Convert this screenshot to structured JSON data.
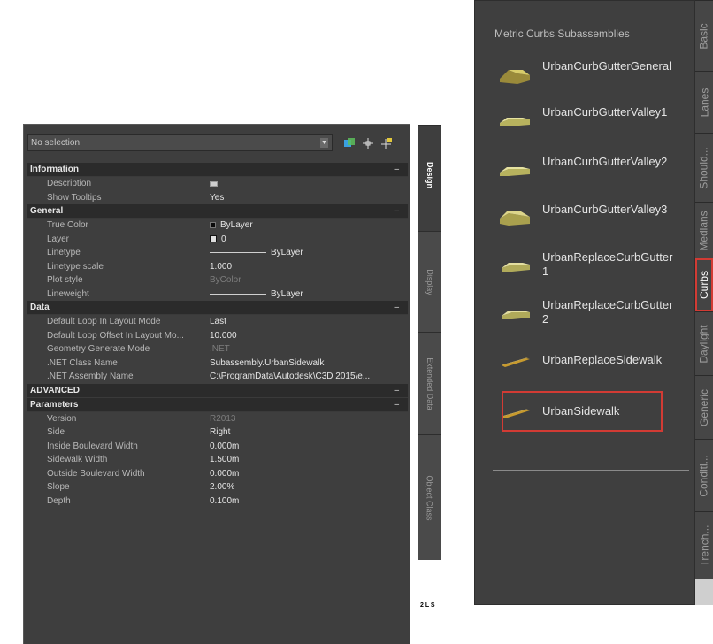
{
  "properties": {
    "selection": "No selection",
    "icons": [
      "quick-select-icon",
      "select-objects-icon",
      "pickadd-icon"
    ],
    "categories": [
      {
        "title": "Information",
        "rows": [
          {
            "key": "Description",
            "value": "",
            "icon": "description-icon"
          },
          {
            "key": "Show Tooltips",
            "value": "Yes"
          }
        ]
      },
      {
        "title": "General",
        "rows": [
          {
            "key": "True Color",
            "value": "ByLayer"
          },
          {
            "key": "Layer",
            "value": "0"
          },
          {
            "key": "Linetype",
            "value": "ByLayer"
          },
          {
            "key": "Linetype scale",
            "value": "1.000"
          },
          {
            "key": "Plot style",
            "value": "ByColor"
          },
          {
            "key": "Lineweight",
            "value": "ByLayer"
          }
        ]
      },
      {
        "title": "Data",
        "rows": [
          {
            "key": "Default Loop In Layout Mode",
            "value": "Last"
          },
          {
            "key": "Default Loop Offset In Layout Mo...",
            "value": "10.000"
          },
          {
            "key": "Geometry Generate Mode",
            "value": ".NET"
          },
          {
            "key": ".NET Class Name",
            "value": "Subassembly.UrbanSidewalk"
          },
          {
            "key": ".NET Assembly Name",
            "value": "C:\\ProgramData\\Autodesk\\C3D 2015\\e..."
          }
        ]
      },
      {
        "title": "ADVANCED",
        "rows": []
      },
      {
        "title": "Parameters",
        "rows": [
          {
            "key": "Version",
            "value": "R2013"
          },
          {
            "key": "Side",
            "value": "Right"
          },
          {
            "key": "Inside Boulevard Width",
            "value": "0.000m"
          },
          {
            "key": "Sidewalk Width",
            "value": "1.500m"
          },
          {
            "key": "Outside Boulevard Width",
            "value": "0.000m"
          },
          {
            "key": "Slope",
            "value": "2.00%"
          },
          {
            "key": "Depth",
            "value": "0.100m"
          }
        ]
      }
    ],
    "side_tabs": [
      "Design",
      "Display",
      "Extended Data",
      "Object Class"
    ],
    "corner_text": "2 L S"
  },
  "tool_palette": {
    "title": "Metric Curbs Subassemblies",
    "tools": [
      {
        "name": "UrbanCurbGutterGeneral",
        "icon": "curb-gutter-general-icon"
      },
      {
        "name": "UrbanCurbGutterValley1",
        "icon": "curb-gutter-valley-icon"
      },
      {
        "name": "UrbanCurbGutterValley2",
        "icon": "curb-gutter-valley-icon"
      },
      {
        "name": "UrbanCurbGutterValley3",
        "icon": "curb-gutter-valley-icon"
      },
      {
        "name": "UrbanReplaceCurbGutter1",
        "icon": "replace-curb-gutter-icon"
      },
      {
        "name": "UrbanReplaceCurbGutter2",
        "icon": "replace-curb-gutter-icon"
      },
      {
        "name": "UrbanReplaceSidewalk",
        "icon": "replace-sidewalk-icon"
      },
      {
        "name": "UrbanSidewalk",
        "icon": "sidewalk-icon"
      }
    ],
    "highlighted_tool": "UrbanSidewalk",
    "tabs": [
      "Basic",
      "Lanes",
      "Should...",
      "Medians",
      "Curbs",
      "Daylight",
      "Generic",
      "Conditi...",
      "Trench..."
    ],
    "active_tab": "Curbs",
    "accent_color": "#d23b34"
  }
}
